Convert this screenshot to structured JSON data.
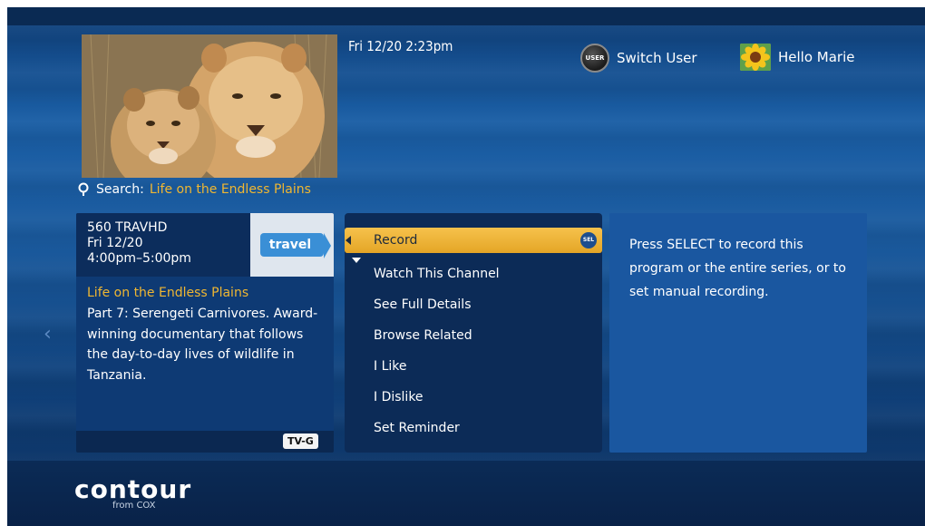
{
  "header": {
    "datetime": "Fri 12/20  2:23pm",
    "user_icon_text": "USER",
    "switch_user_label": "Switch User",
    "greeting": "Hello Marie"
  },
  "search": {
    "label": "Search:",
    "term": "Life on the Endless Plains"
  },
  "program": {
    "channel": "560 TRAVHD",
    "date": "Fri 12/20",
    "time": "4:00pm–5:00pm",
    "network_logo": "travel",
    "title": "Life on the Endless Plains",
    "description": "Part 7: Serengeti Carnivores. Award-winning documentary that follows the day-to-day lives of wildlife in Tanzania.",
    "rating": "TV-G"
  },
  "menu": {
    "selected_icon_text": "SEL",
    "items": [
      {
        "label": "Record"
      },
      {
        "label": "Watch This Channel"
      },
      {
        "label": "See Full Details"
      },
      {
        "label": "Browse Related"
      },
      {
        "label": "I Like"
      },
      {
        "label": "I Dislike"
      },
      {
        "label": "Set Reminder"
      }
    ]
  },
  "help": {
    "text": "Press SELECT to record this program or the entire series, or to set manual recording."
  },
  "brand": {
    "name": "contour",
    "sub": "from COX"
  },
  "colors": {
    "accent": "#f0b732",
    "background": "#1a5ea5",
    "panel_dark": "#0c2b57",
    "selection": "#f6c24c"
  }
}
